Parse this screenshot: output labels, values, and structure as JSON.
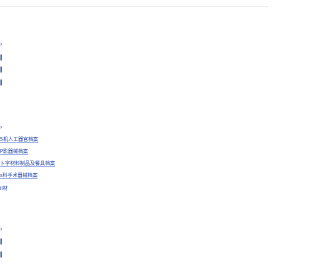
{
  "sidebar": {
    "group1": {
      "marks": [
        "›",
        "ǀ",
        "ǀ",
        "ǀ"
      ]
    },
    "group2": {
      "mark": "›",
      "items": [
        {
          "label": "5机人工器官档案"
        },
        {
          "label": "P影器械档案"
        },
        {
          "label": "卜字材料制品及餐具档案"
        },
        {
          "label": "s科手术器械档案"
        },
        {
          "label": "il材"
        }
      ]
    },
    "group3": {
      "marks": [
        "›",
        "ǀ",
        "ǀ"
      ]
    }
  }
}
